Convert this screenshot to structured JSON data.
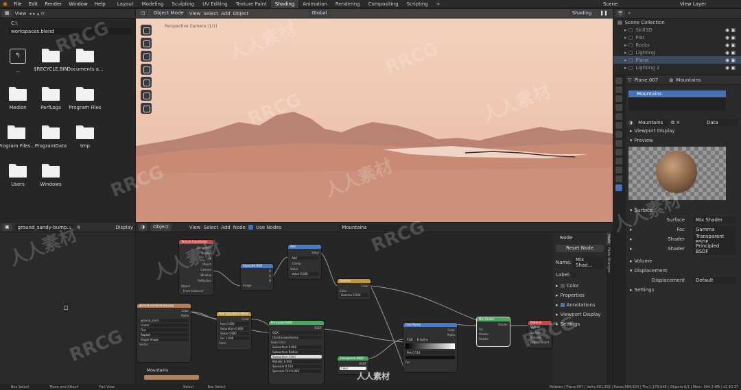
{
  "topbar": {
    "menus": [
      "File",
      "Edit",
      "Render",
      "Window",
      "Help"
    ],
    "workspaces": [
      "Layout",
      "Modeling",
      "Sculpting",
      "UV Editing",
      "Texture Paint",
      "Shading",
      "Animation",
      "Rendering",
      "Compositing",
      "Scripting"
    ],
    "active_workspace": "Shading",
    "add_label": "+",
    "scene_label": "Scene",
    "viewlayer_label": "View Layer"
  },
  "filebrowser": {
    "view_label": "View",
    "path_drive": "C:\\",
    "path_file": "workspaces.blend",
    "items": [
      {
        "name": "..",
        "type": "parent"
      },
      {
        "name": "$RECYCLE.BIN"
      },
      {
        "name": "Documents a..."
      },
      {
        "name": "Medion"
      },
      {
        "name": "PerfLogs"
      },
      {
        "name": "Program Files"
      },
      {
        "name": "Program Files..."
      },
      {
        "name": "ProgramData"
      },
      {
        "name": "tmp"
      },
      {
        "name": "Users"
      },
      {
        "name": "Windows"
      }
    ]
  },
  "viewport": {
    "mode": "Object Mode",
    "menus": [
      "View",
      "Select",
      "Add",
      "Object"
    ],
    "transform": "Global",
    "camera_label": "Perspective Camera (1/1)",
    "shading": "Shading"
  },
  "image_editor": {
    "image_name": "ground_sandy-bump...",
    "users": "4",
    "display": "Display"
  },
  "node_editor": {
    "object": "Object",
    "menus": [
      "View",
      "Select",
      "Add",
      "Node"
    ],
    "use_nodes": "Use Nodes",
    "material": "Mountains",
    "frame_label": "Mountains",
    "nodes": [
      {
        "title": "Texture Coordinate",
        "color": "#c24a4a",
        "rows": [
          "Generated",
          "Normal",
          "UV",
          "Object",
          "Camera",
          "Window",
          "Reflection",
          "Object",
          "From Instancer"
        ]
      },
      {
        "title": "Separate RGB",
        "color": "#4a7bc2",
        "rows": [
          "R",
          "G",
          "B",
          "Image"
        ]
      },
      {
        "title": "Add",
        "color": "#4a7bc2",
        "rows": [
          "Value",
          "Add",
          "Clamp",
          "Value",
          "Value 0.500"
        ]
      },
      {
        "title": "Gamma",
        "color": "#c29a3a",
        "rows": [
          "Color",
          "Color",
          "Gamma 0.500"
        ]
      },
      {
        "title": "ground_sandy-bump.png",
        "color": "#b3805a",
        "rows": [
          "Color",
          "Alpha",
          "ground_sand...",
          "Linear",
          "Flat",
          "Repeat",
          "Single Image",
          "Vector"
        ]
      },
      {
        "title": "Hue Saturation Value",
        "color": "#c29a3a",
        "rows": [
          "Color",
          "Hue 0.500",
          "Saturation 0.000",
          "Value 0.900",
          "Fac 1.000",
          "Color"
        ]
      },
      {
        "title": "Principled BSDF",
        "color": "#4aa860",
        "rows": [
          "BSDF",
          "GGX",
          "Christensen-Burley",
          "Base Color",
          "Subsurface 0.000",
          "Subsurface Radius",
          "Subsurface Color",
          "Metallic 0.000",
          "Specular 0.110",
          "Specular Tint 0.000"
        ]
      },
      {
        "title": "Transparent BSDF",
        "color": "#4aa860",
        "rows": [
          "BSDF",
          "Color"
        ]
      },
      {
        "title": "ColorRamp",
        "color": "#4a7bc2",
        "rows": [
          "Color",
          "Alpha",
          "RGB",
          "B-Spline",
          "Pos 0.518",
          "Fac"
        ]
      },
      {
        "title": "Mix Shader",
        "color": "#4aa860",
        "rows": [
          "Shader",
          "Fac",
          "Shader",
          "Shader"
        ]
      },
      {
        "title": "Material Output",
        "color": "#c24a4a",
        "rows": [
          "All",
          "Surface",
          "Volume",
          "Displacement"
        ]
      }
    ],
    "sidebar": {
      "section": "Node",
      "reset": "Reset Node",
      "name_label": "Name:",
      "name_value": "Mix Shad...",
      "label_label": "Label:",
      "color": "Color",
      "properties": "Properties",
      "annotations": "Annotations",
      "viewport_display": "Viewport Display",
      "settings": "Settings"
    },
    "tabs": [
      "Node",
      "Tool",
      "View",
      "Node Wrangler"
    ]
  },
  "outliner": {
    "title": "Scene Collection",
    "rows": [
      "Skill3D",
      "Plat",
      "Rocks",
      "Lighting",
      "Plane",
      "Lighting 2"
    ]
  },
  "properties": {
    "object": "Plane.007",
    "material": "Mountains",
    "slot": "Mountains",
    "data": "Data",
    "viewport_display": "Viewport Display",
    "preview": "Preview",
    "surface": "Surface",
    "surface_label": "Surface",
    "surface_value": "Mix Shader",
    "fac_label": "Fac",
    "fac_value": "Gamma",
    "shader1_label": "Shader",
    "shader1_value": "Transparent BSDF",
    "shader2_label": "Shader",
    "shader2_value": "Principled BSDF",
    "volume": "Volume",
    "displacement": "Displacement",
    "disp_label": "Displacement",
    "disp_value": "Default",
    "settings": "Settings"
  },
  "statusbar": {
    "items": [
      "Box Select",
      "Move and Attach",
      "Pan View",
      "Select",
      "Box Select"
    ],
    "stats": "Pebbles | Plane.007 | Verts:591,361 | Faces:589,824 | Tris:1,179,648 | Objects:0/1 | Mem: 994.3 MB | v2.90.37"
  },
  "watermark": {
    "text1": "RRCG",
    "text2": "人人素材",
    "site": "人人素材"
  },
  "colors": {
    "accent": "#4772b3",
    "sky": "#f0c9b5",
    "ground": "#c98a74"
  }
}
